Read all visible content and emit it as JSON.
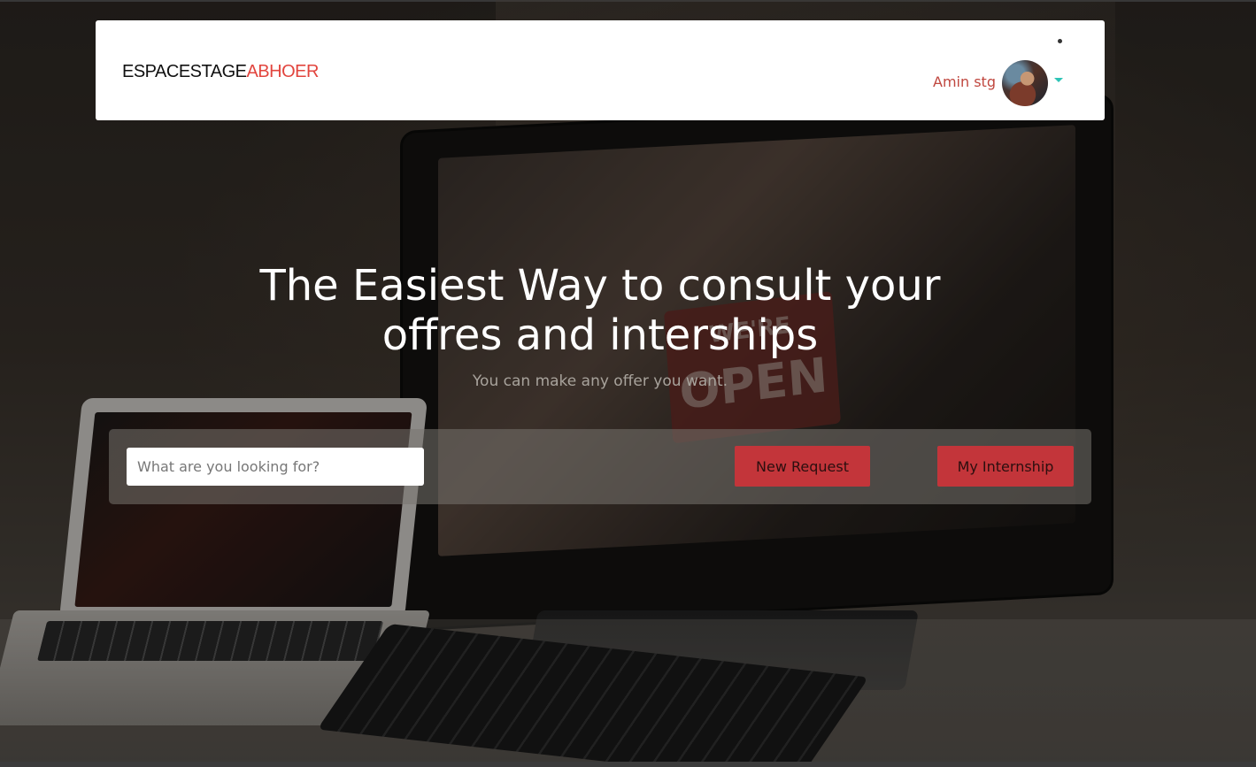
{
  "navbar": {
    "brand_part1": "ESPACESTAGE",
    "brand_part2": "ABHOER",
    "user_name": "Amin stg",
    "avatar_icon": "user-avatar",
    "dropdown_icon": "caret-down-icon"
  },
  "hero": {
    "title_line1": "The Easiest Way to consult your",
    "title_line2": "offres and interships",
    "subtitle": "You can make any offer you want."
  },
  "search": {
    "placeholder": "What are you looking for?",
    "value": ""
  },
  "actions": {
    "new_request_label": "New Request",
    "my_internship_label": "My Internship"
  },
  "background_sign": {
    "line1": "WE'RE",
    "line2": "OPEN"
  },
  "colors": {
    "brand_accent": "#e2453e",
    "button_bg": "#c3353a",
    "caret": "#2ec4b6"
  }
}
